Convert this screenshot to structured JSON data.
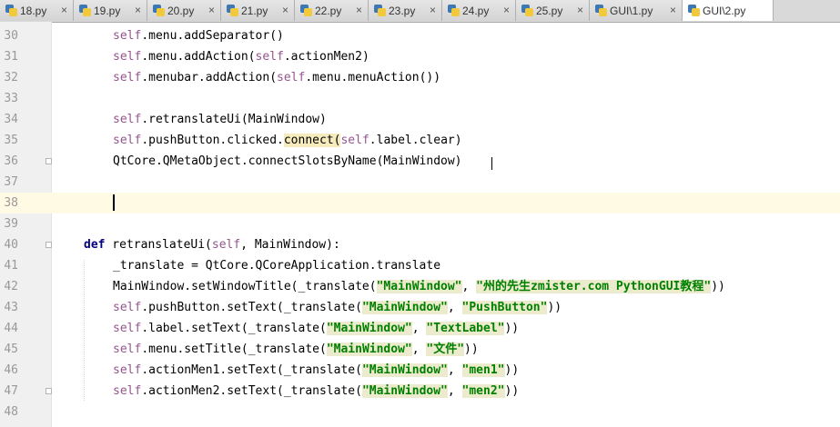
{
  "tabs": [
    {
      "label": "18.py",
      "active": false
    },
    {
      "label": "19.py",
      "active": false
    },
    {
      "label": "20.py",
      "active": false
    },
    {
      "label": "21.py",
      "active": false
    },
    {
      "label": "22.py",
      "active": false
    },
    {
      "label": "23.py",
      "active": false
    },
    {
      "label": "24.py",
      "active": false
    },
    {
      "label": "25.py",
      "active": false
    },
    {
      "label": "GUI\\1.py",
      "active": false
    },
    {
      "label": "GUI\\2.py",
      "active": true
    }
  ],
  "close_glyph": "×",
  "lines": {
    "l30": "30",
    "l31": "31",
    "l32": "32",
    "l33": "33",
    "l34": "34",
    "l35": "35",
    "l36": "36",
    "l37": "37",
    "l38": "38",
    "l39": "39",
    "l40": "40",
    "l41": "41",
    "l42": "42",
    "l43": "43",
    "l44": "44",
    "l45": "45",
    "l46": "46",
    "l47": "47",
    "l48": "48"
  },
  "code": {
    "self": "self",
    "menu_addsep": ".menu.addSeparator()",
    "menu_addaction": ".menu.addAction(",
    "actionmen2": ".actionMen2)",
    "menubar_addaction": ".menubar.addAction(",
    "menu_menuaction": ".menu.menuAction())",
    "retranslate_call": ".retranslateUi(MainWindow)",
    "pushbutton_clicked": ".pushButton.clicked.",
    "connect": "connect",
    "open_paren": "(",
    "label_clear": ".label.clear)",
    "qtcore_connect": "QtCore.QMetaObject.connectSlotsByName(MainWindow)",
    "def_kw": "def",
    "retranslate_def": " retranslateUi(",
    "def_args": ", MainWindow):",
    "translate_assign": "_translate = QtCore.QCoreApplication.translate",
    "setwindowtitle": "MainWindow.setWindowTitle(_translate(",
    "str_mainwindow": "\"MainWindow\"",
    "comma": ", ",
    "str_title": "\"州的先生zmister.com PythonGUI教程\"",
    "close2": "))",
    "pushbutton_settext": ".pushButton.setText(_translate(",
    "str_pushbutton": "\"PushButton\"",
    "label_settext": ".label.setText(_translate(",
    "str_textlabel": "\"TextLabel\"",
    "menu_settitle": ".menu.setTitle(_translate(",
    "str_wenjian": "\"文件\"",
    "actionmen1_settext": ".actionMen1.setText(_translate(",
    "str_men1": "\"men1\"",
    "actionmen2_settext": ".actionMen2.setText(_translate(",
    "str_men2": "\"men2\""
  },
  "colors": {
    "self": "#94558d",
    "keyword": "#000080",
    "string": "#008000",
    "caret_row": "#fffae3",
    "tabbar": "#d9d9d9"
  }
}
